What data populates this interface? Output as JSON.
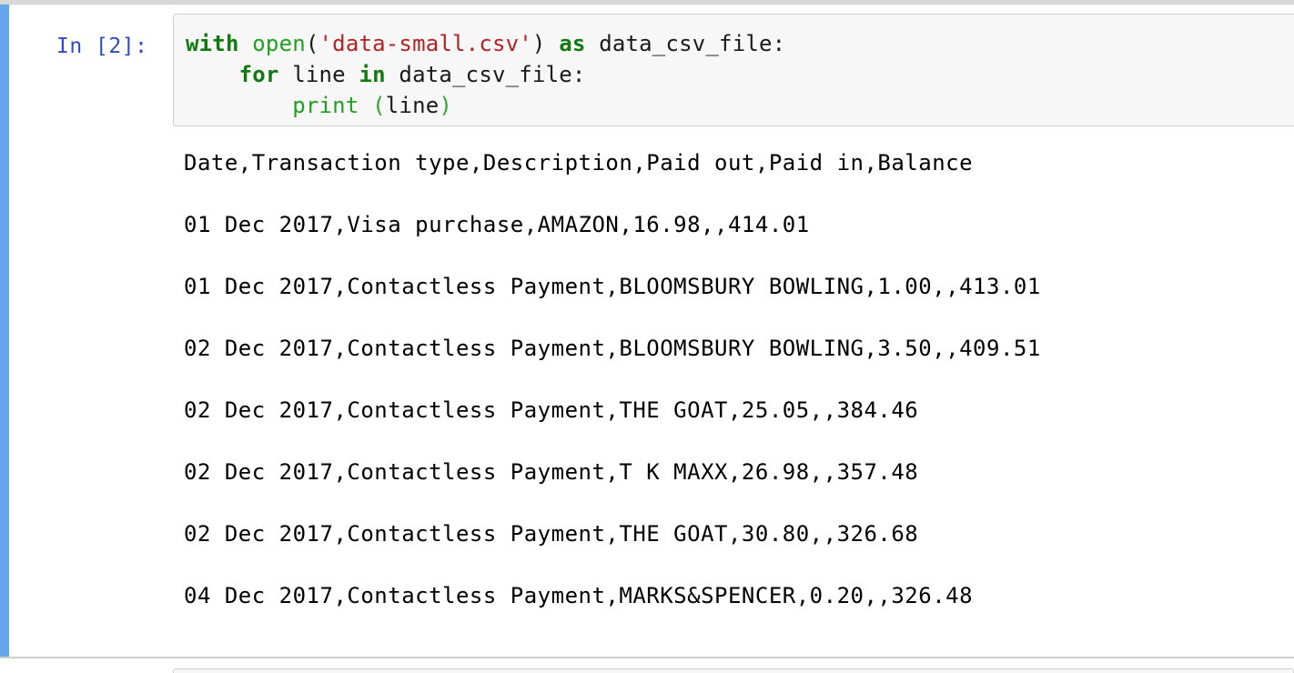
{
  "cell": {
    "prompt": "In [2]:",
    "code": {
      "line1": {
        "kw_with": "with",
        "sp1": " ",
        "fn_open": "open",
        "paren_open": "(",
        "str_file": "'data-small.csv'",
        "paren_close": ")",
        "sp2": " ",
        "kw_as": "as",
        "rest": " data_csv_file:"
      },
      "line2": {
        "indent": "    ",
        "kw_for": "for",
        "mid": " line ",
        "kw_in": "in",
        "rest": " data_csv_file:"
      },
      "line3": {
        "indent": "        ",
        "fn_print": "print",
        "sp": " ",
        "paren_open": "(",
        "arg": "line",
        "paren_close": ")"
      }
    },
    "output_lines": [
      "Date,Transaction type,Description,Paid out,Paid in,Balance",
      "01 Dec 2017,Visa purchase,AMAZON,16.98,,414.01",
      "01 Dec 2017,Contactless Payment,BLOOMSBURY BOWLING,1.00,,413.01",
      "02 Dec 2017,Contactless Payment,BLOOMSBURY BOWLING,3.50,,409.51",
      "02 Dec 2017,Contactless Payment,THE GOAT,25.05,,384.46",
      "02 Dec 2017,Contactless Payment,T K MAXX,26.98,,357.48",
      "02 Dec 2017,Contactless Payment,THE GOAT,30.80,,326.68",
      "04 Dec 2017,Contactless Payment,MARKS&SPENCER,0.20,,326.48"
    ]
  },
  "colors": {
    "selection_bar": "#66a6ea",
    "prompt": "#2f4bbf",
    "keyword": "#107a10",
    "builtin": "#20a020",
    "string": "#b22222",
    "input_bg": "#f7f7f7"
  }
}
